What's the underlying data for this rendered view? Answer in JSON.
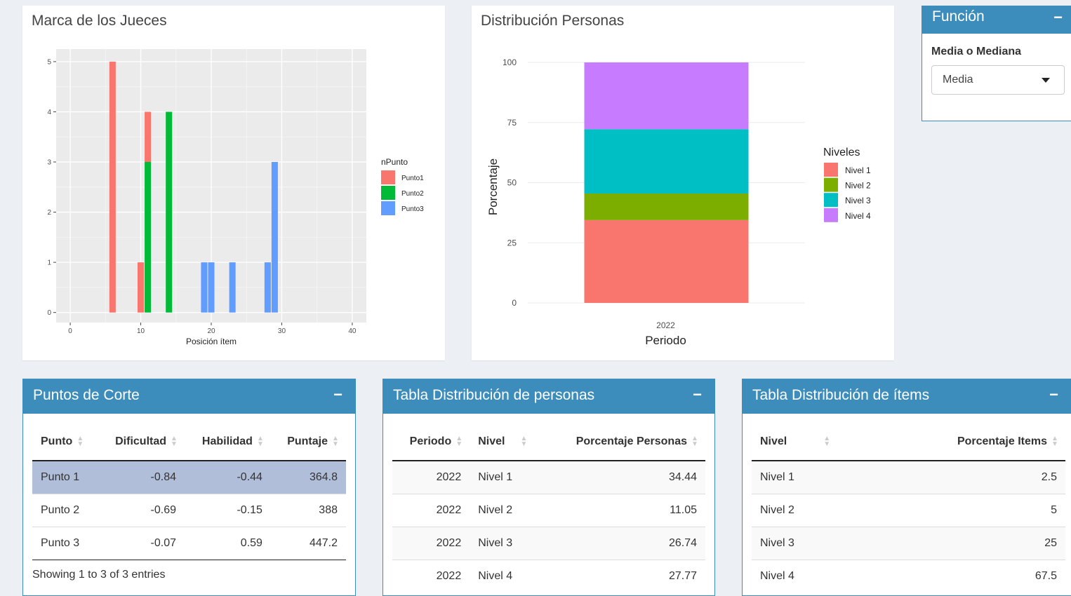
{
  "judges_chart": {
    "title": "Marca de los Jueces",
    "chart_data": {
      "type": "bar",
      "xlabel": "Posición ítem",
      "ylabel": "",
      "xlim": [
        -2,
        42
      ],
      "ylim": [
        -0.2,
        5.25
      ],
      "x_ticks": [
        "0",
        "10",
        "20",
        "30",
        "40"
      ],
      "y_ticks": [
        "0",
        "1",
        "2",
        "3",
        "4",
        "5"
      ],
      "legend_title": "nPunto",
      "legend_position": "right",
      "series": [
        {
          "name": "Punto1",
          "color": "#f8766d"
        },
        {
          "name": "Punto2",
          "color": "#00ba38"
        },
        {
          "name": "Punto3",
          "color": "#619cff"
        }
      ],
      "bars": [
        {
          "x": 6,
          "segments": [
            {
              "series": "Punto1",
              "value": 5
            }
          ]
        },
        {
          "x": 10,
          "segments": [
            {
              "series": "Punto1",
              "value": 1
            }
          ]
        },
        {
          "x": 11,
          "segments": [
            {
              "series": "Punto2",
              "value": 3
            },
            {
              "series": "Punto1",
              "value": 1
            }
          ]
        },
        {
          "x": 14,
          "segments": [
            {
              "series": "Punto2",
              "value": 4
            }
          ]
        },
        {
          "x": 19,
          "segments": [
            {
              "series": "Punto3",
              "value": 1
            }
          ]
        },
        {
          "x": 20,
          "segments": [
            {
              "series": "Punto3",
              "value": 1
            }
          ]
        },
        {
          "x": 23,
          "segments": [
            {
              "series": "Punto3",
              "value": 1
            }
          ]
        },
        {
          "x": 28,
          "segments": [
            {
              "series": "Punto3",
              "value": 1
            }
          ]
        },
        {
          "x": 29,
          "segments": [
            {
              "series": "Punto3",
              "value": 3
            }
          ]
        }
      ]
    }
  },
  "people_chart": {
    "title": "Distribución Personas",
    "chart_data": {
      "type": "bar",
      "stacked": true,
      "categories": [
        "2022"
      ],
      "xlabel": "Periodo",
      "ylabel": "Porcentaje",
      "ylim": [
        0,
        100
      ],
      "y_ticks": [
        "0",
        "25",
        "50",
        "75",
        "100"
      ],
      "legend_title": "Niveles",
      "legend_position": "right",
      "series": [
        {
          "name": "Nivel 1",
          "values": [
            34.44
          ],
          "color": "#f8766d"
        },
        {
          "name": "Nivel 2",
          "values": [
            11.05
          ],
          "color": "#7cae00"
        },
        {
          "name": "Nivel 3",
          "values": [
            26.74
          ],
          "color": "#00bfc4"
        },
        {
          "name": "Nivel 4",
          "values": [
            27.77
          ],
          "color": "#c77cff"
        }
      ]
    }
  },
  "funcion": {
    "title": "Función",
    "collapse": "−",
    "label": "Media o Mediana",
    "selected": "Media"
  },
  "puntos": {
    "title": "Puntos de Corte",
    "collapse": "−",
    "headers": [
      "Punto",
      "Dificultad",
      "Habilidad",
      "Puntaje"
    ],
    "rows": [
      [
        "Punto 1",
        "-0.84",
        "-0.44",
        "364.8"
      ],
      [
        "Punto 2",
        "-0.69",
        "-0.15",
        "388"
      ],
      [
        "Punto 3",
        "-0.07",
        "0.59",
        "447.2"
      ]
    ],
    "info": "Showing 1 to 3 of 3 entries"
  },
  "dist_personas": {
    "title": "Tabla Distribución de personas",
    "collapse": "−",
    "headers": [
      "Periodo",
      "Nivel",
      "Porcentaje Personas"
    ],
    "rows": [
      [
        "2022",
        "Nivel 1",
        "34.44"
      ],
      [
        "2022",
        "Nivel 2",
        "11.05"
      ],
      [
        "2022",
        "Nivel 3",
        "26.74"
      ],
      [
        "2022",
        "Nivel 4",
        "27.77"
      ]
    ]
  },
  "dist_items": {
    "title": "Tabla Distribución de ítems",
    "collapse": "−",
    "headers": [
      "Nivel",
      "Porcentaje Items"
    ],
    "rows": [
      [
        "Nivel 1",
        "2.5"
      ],
      [
        "Nivel 2",
        "5"
      ],
      [
        "Nivel 3",
        "25"
      ],
      [
        "Nivel 4",
        "67.5"
      ]
    ]
  }
}
